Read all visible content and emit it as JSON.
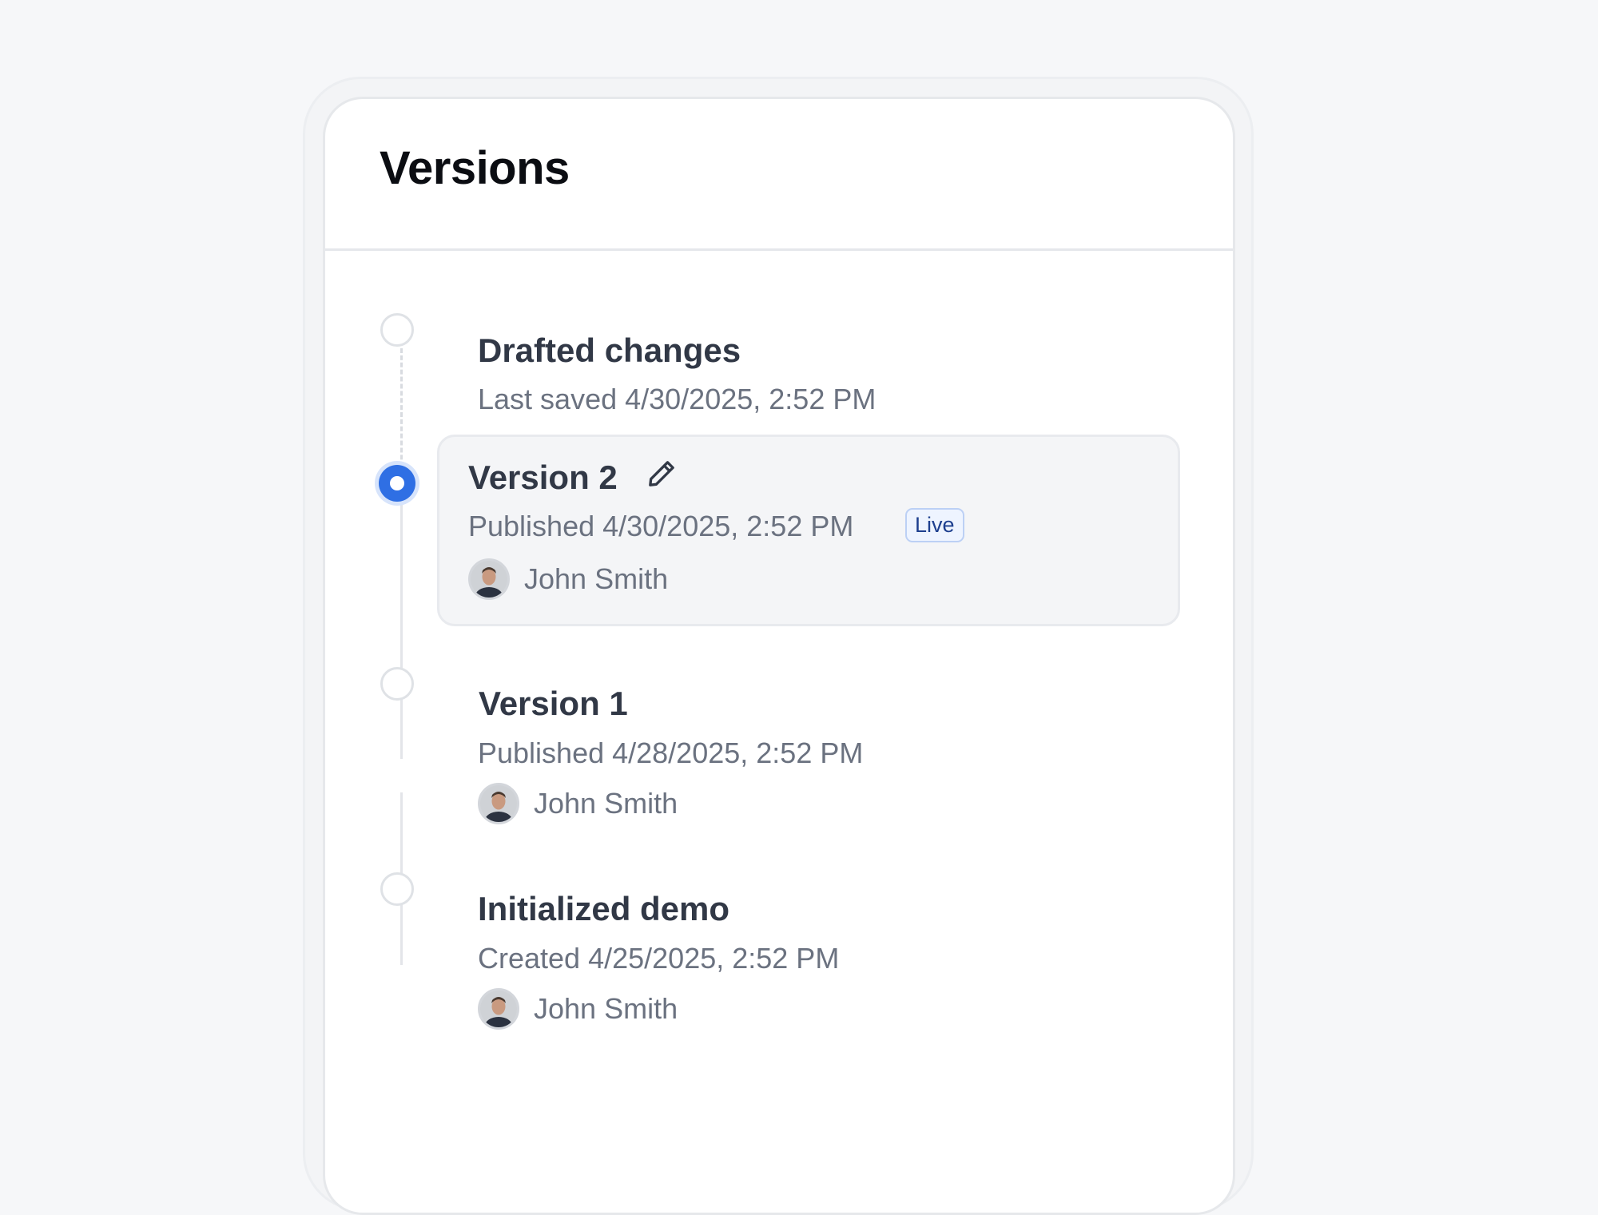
{
  "panel": {
    "title": "Versions"
  },
  "timeline": {
    "entries": [
      {
        "title": "Drafted changes",
        "meta": "Last saved 4/30/2025, 2:52 PM"
      },
      {
        "title": "Version 2",
        "meta": "Published 4/30/2025, 2:52 PM",
        "badge": "Live",
        "author": "John Smith",
        "selected": true,
        "edit_icon": "pencil-icon"
      },
      {
        "title": "Version 1",
        "meta": "Published 4/28/2025, 2:52 PM",
        "author": "John Smith"
      },
      {
        "title": "Initialized demo",
        "meta": "Created 4/25/2025, 2:52 PM",
        "author": "John Smith"
      }
    ]
  },
  "colors": {
    "accent": "#2f6fe4",
    "page_background": "#f6f7f9",
    "title_text": "#313846",
    "meta_text": "#6b7280"
  }
}
